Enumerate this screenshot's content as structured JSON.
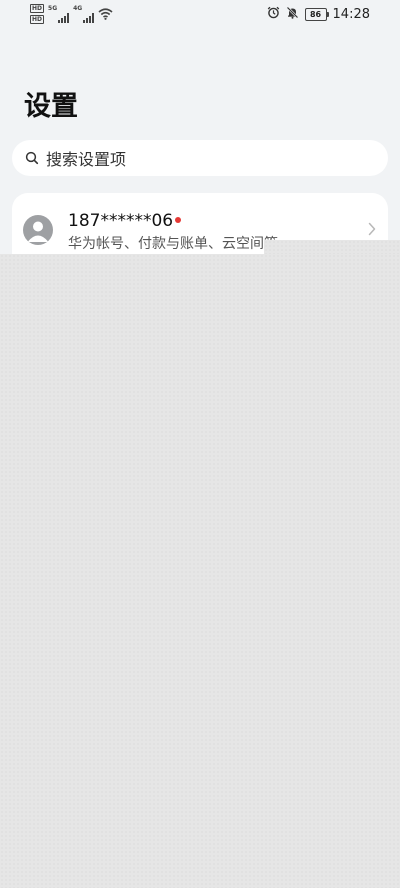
{
  "status_bar": {
    "hd_badge_1": "HD",
    "hd_badge_2": "HD",
    "network_1": "5G",
    "network_2": "4G",
    "battery_level": "86",
    "time": "14:28",
    "icons": [
      "alarm-icon",
      "mute-icon",
      "wifi-icon",
      "battery-icon"
    ]
  },
  "page": {
    "title": "设置"
  },
  "search": {
    "placeholder": "搜索设置项"
  },
  "account": {
    "name": "187******06",
    "subtitle": "华为帐号、付款与账单、云空间等",
    "has_notification": true,
    "notification_color": "#e53935"
  },
  "colors": {
    "background": "#f1f3f5",
    "card": "#ffffff"
  }
}
